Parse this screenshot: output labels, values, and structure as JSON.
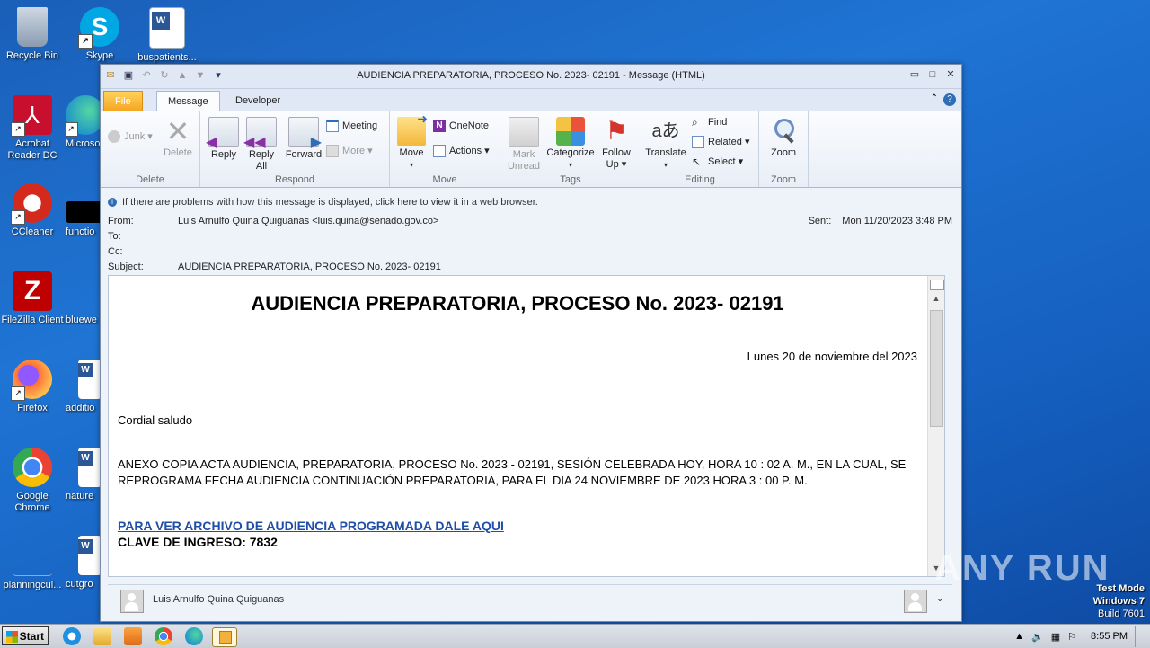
{
  "desktop": {
    "icons": [
      {
        "label": "Recycle Bin",
        "name": "recycle-bin-icon"
      },
      {
        "label": "Skype",
        "name": "skype-icon"
      },
      {
        "label": "buspatients...",
        "name": "word-document-icon"
      },
      {
        "label": "Acrobat Reader DC",
        "name": "acrobat-reader-icon"
      },
      {
        "label": "Microso",
        "name": "edge-icon"
      },
      {
        "label": "CCleaner",
        "name": "ccleaner-icon"
      },
      {
        "label": "functio",
        "name": "black-file-icon"
      },
      {
        "label": "FileZilla Client",
        "name": "filezilla-icon"
      },
      {
        "label": "bluewe",
        "name": "file-icon"
      },
      {
        "label": "Firefox",
        "name": "firefox-icon"
      },
      {
        "label": "additio",
        "name": "word-document-icon"
      },
      {
        "label": "Google Chrome",
        "name": "chrome-icon"
      },
      {
        "label": "nature",
        "name": "word-document-icon"
      },
      {
        "label": "planningcul...",
        "name": "file-icon"
      },
      {
        "label": "cutgro",
        "name": "word-document-icon"
      }
    ]
  },
  "window": {
    "title": "AUDIENCIA PREPARATORIA, PROCESO No. 2023- 02191 - Message (HTML)",
    "tabs": {
      "file": "File",
      "message": "Message",
      "developer": "Developer"
    },
    "ribbon": {
      "delete_group": {
        "label": "Delete",
        "junk": "Junk",
        "delete": "Delete"
      },
      "respond_group": {
        "label": "Respond",
        "reply": "Reply",
        "reply_all_1": "Reply",
        "reply_all_2": "All",
        "forward": "Forward",
        "meeting": "Meeting",
        "more": "More"
      },
      "move_group": {
        "label": "Move",
        "move": "Move",
        "onenote": "OneNote",
        "actions": "Actions"
      },
      "tags_group": {
        "label": "Tags",
        "mark_1": "Mark",
        "mark_2": "Unread",
        "categorize": "Categorize",
        "follow_1": "Follow",
        "follow_2": "Up"
      },
      "editing_group": {
        "label": "Editing",
        "translate": "Translate",
        "find": "Find",
        "related": "Related",
        "select": "Select"
      },
      "zoom_group": {
        "label": "Zoom",
        "zoom": "Zoom"
      }
    },
    "infobar": "If there are problems with how this message is displayed, click here to view it in a web browser.",
    "header": {
      "from_label": "From:",
      "from_value": "Luis Arnulfo Quina Quiguanas <luis.quina@senado.gov.co>",
      "to_label": "To:",
      "cc_label": "Cc:",
      "subject_label": "Subject:",
      "subject_value": "AUDIENCIA PREPARATORIA, PROCESO No. 2023- 02191",
      "sent_label": "Sent:",
      "sent_value": "Mon 11/20/2023 3:48 PM"
    },
    "body": {
      "title": "AUDIENCIA PREPARATORIA, PROCESO No. 2023- 02191",
      "date": "Lunes 20 de noviembre del 2023",
      "greeting": "Cordial saludo",
      "para1": "ANEXO COPIA ACTA AUDIENCIA, PREPARATORIA, PROCESO No. 2023 - 02191, SESIÓN CELEBRADA HOY, HORA 10 : 02 A. M., EN LA CUAL, SE",
      "para2": "REPROGRAMA FECHA AUDIENCIA CONTINUACIÓN PREPARATORIA, PARA EL DIA 24 NOVIEMBRE DE 2023 HORA 3 : 00 P. M.",
      "link": "PARA VER ARCHIVO DE AUDIENCIA PROGRAMADA DALE AQUI",
      "password": "CLAVE DE INGRESO: 7832"
    },
    "people_pane": {
      "name": "Luis Arnulfo Quina Quiguanas"
    }
  },
  "taskbar": {
    "start": "Start",
    "clock": "8:55 PM"
  },
  "watermark": {
    "line1": "Test Mode",
    "line2": "Windows 7",
    "line3": "Build 7601",
    "brand": "ANY RUN"
  }
}
